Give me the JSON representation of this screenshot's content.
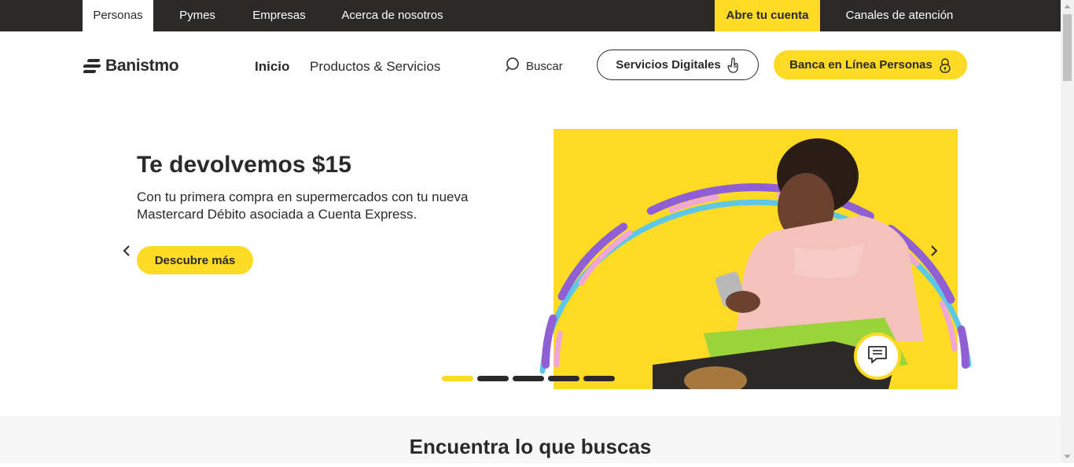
{
  "topbar": {
    "tabs": [
      "Personas",
      "Pymes",
      "Empresas",
      "Acerca de nosotros"
    ],
    "cta": "Abre tu cuenta",
    "channels": "Canales de atención"
  },
  "header": {
    "logo": "Banistmo",
    "nav": [
      "Inicio",
      "Productos & Servicios"
    ],
    "search_label": "Buscar",
    "digital_services": "Servicios Digitales",
    "online_banking": "Banca en Línea Personas"
  },
  "hero": {
    "title": "Te devolvemos $15",
    "description": "Con tu primera compra en supermercados con tu nueva Mastercard Débito asociada a Cuenta Express.",
    "cta": "Descubre más",
    "slides_total": 5,
    "active_slide": 1
  },
  "section": {
    "title": "Encuentra lo que buscas"
  },
  "colors": {
    "brand_yellow": "#fdda24",
    "dark": "#2c2a29",
    "purple": "#8f5fd3",
    "pink": "#f0a7d6",
    "cyan": "#5cc8e6"
  },
  "icons": [
    "search-icon",
    "hand-pointer-icon",
    "lock-icon",
    "chevron-left-icon",
    "chevron-right-icon",
    "chat-icon"
  ]
}
